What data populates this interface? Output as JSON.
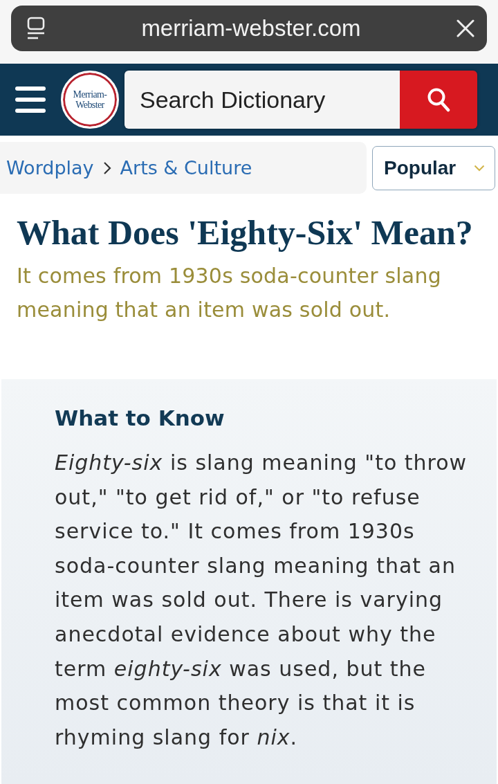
{
  "browser_bar": {
    "url": "merriam-webster.com"
  },
  "header": {
    "logo": {
      "lines": [
        "Merriam-",
        "Webster"
      ]
    },
    "search": {
      "placeholder": "Search Dictionary"
    }
  },
  "breadcrumbs": [
    {
      "label": "Wordplay"
    },
    {
      "label": "Arts & Culture"
    }
  ],
  "sort_dropdown": {
    "label": "Popular"
  },
  "article": {
    "title": "What Does 'Eighty-Six' Mean?",
    "subtitle": "It comes from 1930s soda-counter slang meaning that an item was sold out."
  },
  "what_to_know": {
    "heading": "What to Know",
    "body": "*Eighty-six* is slang meaning \"to throw out,\" \"to get rid of,\" or \"to refuse service to.\" It comes from 1930s soda-counter slang meaning that an item was sold out. There is varying anecdotal evidence about why the term *eighty-six* was used, but the most common theory is that it is rhyming slang for *nix*."
  }
}
